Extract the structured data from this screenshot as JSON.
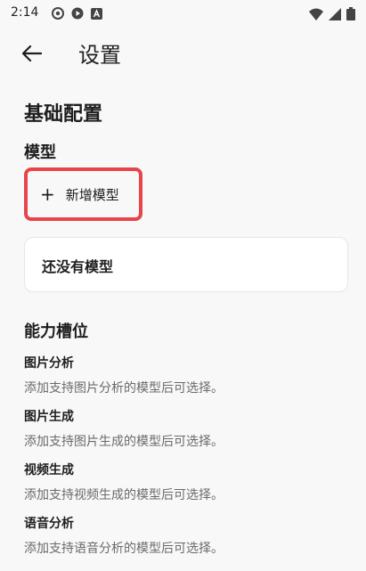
{
  "status_bar": {
    "time": "2:14",
    "icons_left": [
      "settings-gear-icon",
      "play-icon",
      "a-badge-icon"
    ],
    "icons_right": [
      "wifi-icon",
      "signal-icon",
      "battery-icon"
    ]
  },
  "app_bar": {
    "title": "设置",
    "back_icon": "arrow-left-icon"
  },
  "sections": {
    "basic_config": "基础配置",
    "models": "模型",
    "add_model": "新增模型",
    "add_model_icon": "+",
    "no_models": "还没有模型",
    "capability_slots": "能力槽位"
  },
  "slots": [
    {
      "name": "图片分析",
      "desc": "添加支持图片分析的模型后可选择。"
    },
    {
      "name": "图片生成",
      "desc": "添加支持图片生成的模型后可选择。"
    },
    {
      "name": "视频生成",
      "desc": "添加支持视频生成的模型后可选择。"
    },
    {
      "name": "语音分析",
      "desc": "添加支持语音分析的模型后可选择。"
    }
  ],
  "colors": {
    "highlight": "#e8454b",
    "background": "#f8f8f8",
    "card": "#ffffff",
    "secondary_text": "#6a6a6a"
  }
}
